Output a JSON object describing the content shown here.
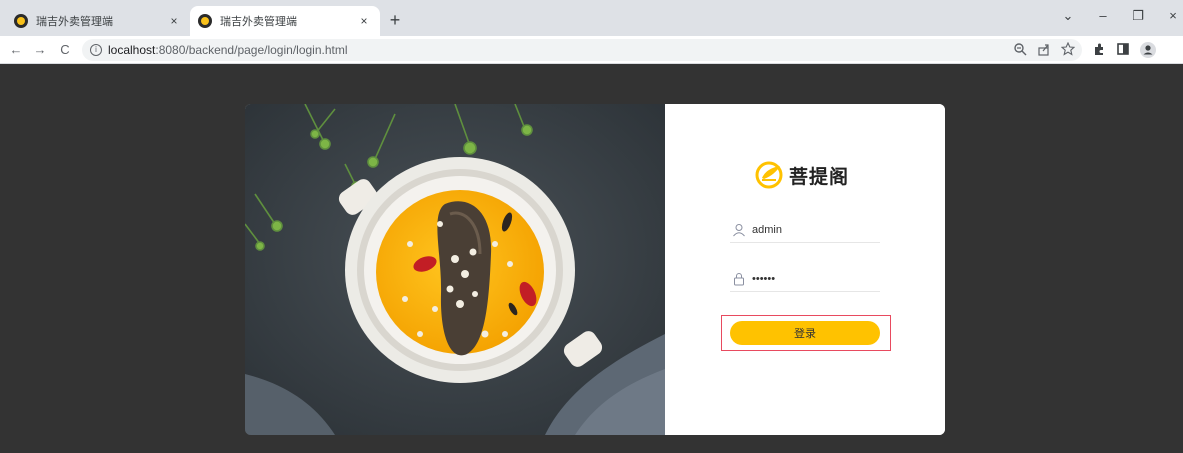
{
  "browser": {
    "tabs": [
      {
        "title": "瑞吉外卖管理端",
        "active": false,
        "close": "×"
      },
      {
        "title": "瑞吉外卖管理端",
        "active": true,
        "close": "×"
      }
    ],
    "new_tab": "+",
    "window_controls": {
      "tab_search": "⌄",
      "minimize": "–",
      "restore": "❐",
      "close": "×"
    },
    "nav": {
      "back": "←",
      "forward": "→",
      "reload": "C"
    },
    "address": {
      "host": "localhost",
      "rest": ":8080/backend/page/login/login.html",
      "info_icon": "i"
    },
    "toolbar_icons": [
      "zoom-icon",
      "share-icon",
      "star-icon",
      "extensions-icon",
      "sidepanel-icon",
      "profile-icon"
    ]
  },
  "login": {
    "brand": "菩提阁",
    "username": {
      "value": "admin",
      "icon": "user-icon"
    },
    "password": {
      "value": "••••••",
      "icon": "lock-icon"
    },
    "submit_label": "登录"
  },
  "colors": {
    "accent": "#ffc200",
    "page_bg": "#333333",
    "focus_outline": "#e84a5f"
  }
}
